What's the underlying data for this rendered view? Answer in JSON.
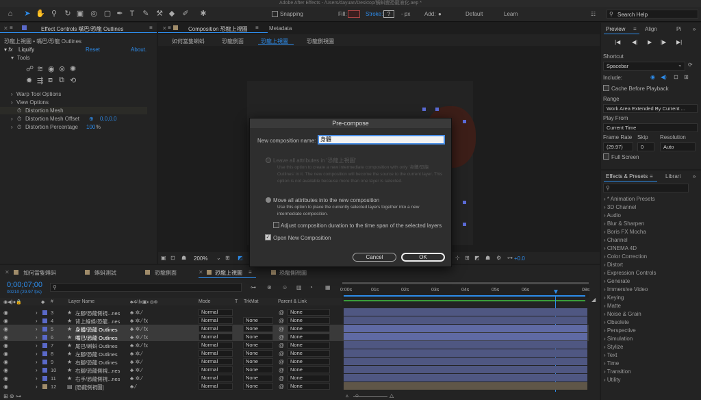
{
  "app": {
    "title": "Adobe After Effects - /Users/dayuan/Desktop/鯛蚪變恐龍液化.aep *"
  },
  "toolbar": {
    "snapping_label": "Snapping",
    "fill_label": "Fill:",
    "stroke_label": "Stroke:",
    "stroke_unit": "- px",
    "add_label": "Add:",
    "workspaces": [
      "Default",
      "Learn"
    ],
    "search_placeholder": "Search Help"
  },
  "effect_controls": {
    "tab_label": "Effect Controls 嘴巴/恐龍 Outlines",
    "breadcrumb": "恐龍上視圖 • 嘴巴/恐龍 Outlines",
    "effect_name": "Liquify",
    "reset_label": "Reset",
    "about_label": "About.",
    "tools_label": "Tools",
    "warp_tool_options": "Warp Tool Options",
    "view_options": "View Options",
    "distortion_mesh": "Distortion Mesh",
    "distortion_mesh_offset_label": "Distortion Mesh Offset",
    "distortion_mesh_offset_value": "0.0,0.0",
    "distortion_percentage_label": "Distortion Percentage",
    "distortion_percentage_value": "100",
    "distortion_percentage_unit": "%"
  },
  "composition": {
    "tab_label": "Composition 恐龍上視圖",
    "metadata_tab": "Metadata",
    "breadcrumbs": [
      "如何當隻蝌蚪",
      "恐龍側面",
      "恐龍上視圖",
      "恐龍側視圖"
    ],
    "zoom": "200%",
    "exposure": "+0.0"
  },
  "dialog": {
    "title": "Pre-compose",
    "name_label": "New composition name:",
    "name_value": "身體",
    "option1_label": "Leave all attributes in '恐龍上視圖'",
    "option1_desc": "Use this option to create a new intermediate composition with only '身體/恐龍 Outlines' in it. The new composition will become the source to the current layer. This option is not available because more than one layer is selected.",
    "option2_label": "Move all attributes into the new composition",
    "option2_desc": "Use this option to place the currently selected layers together into a new intermediate composition.",
    "adjust_label": "Adjust composition duration to the time span of the selected layers",
    "open_new_label": "Open New Composition",
    "cancel_label": "Cancel",
    "ok_label": "OK"
  },
  "preview": {
    "tab_label": "Preview",
    "align_tab": "Align",
    "p_tab": "Pi",
    "shortcut_label": "Shortcut",
    "shortcut_value": "Spacebar",
    "include_label": "Include:",
    "cache_label": "Cache Before Playback",
    "range_label": "Range",
    "range_value": "Work Area Extended By Current ...",
    "play_from_label": "Play From",
    "play_from_value": "Current Time",
    "frame_rate_label": "Frame Rate",
    "skip_label": "Skip",
    "resolution_label": "Resolution",
    "frame_rate_value": "(29.97)",
    "skip_value": "0",
    "resolution_value": "Auto",
    "full_screen_label": "Full Screen"
  },
  "effects_presets": {
    "tab_label": "Effects & Presets",
    "libraries_tab": "Librari",
    "items": [
      "* Animation Presets",
      "3D Channel",
      "Audio",
      "Blur & Sharpen",
      "Boris FX Mocha",
      "Channel",
      "CINEMA 4D",
      "Color Correction",
      "Distort",
      "Expression Controls",
      "Generate",
      "Immersive Video",
      "Keying",
      "Matte",
      "Noise & Grain",
      "Obsolete",
      "Perspective",
      "Simulation",
      "Stylize",
      "Text",
      "Time",
      "Transition",
      "Utility"
    ]
  },
  "timeline": {
    "tabs": [
      "如何當隻蝌蚪",
      "蝌蚪測試",
      "恐龍側面",
      "恐龍上視圖",
      "恐龍側視圖"
    ],
    "timecode": "0;00;07;00",
    "frame_info": "00210 (29.97 fps)",
    "col_layer_name": "Layer Name",
    "col_mode": "Mode",
    "col_t": "T",
    "col_trkmat": "TrkMat",
    "col_parent": "Parent & Link",
    "ruler": [
      "0:00s",
      "01s",
      "02s",
      "03s",
      "04s",
      "05s",
      "06s",
      "08s"
    ],
    "layers": [
      {
        "num": "3",
        "name": "左腳/恐龍側視...nes",
        "mode": "Normal",
        "trkmat": "",
        "parent": "None"
      },
      {
        "num": "4",
        "name": "背上線條/恐龍...nes",
        "mode": "Normal",
        "trkmat": "None",
        "parent": "None"
      },
      {
        "num": "5",
        "name": "身體/恐龍 Outlines",
        "mode": "Normal",
        "trkmat": "None",
        "parent": "None"
      },
      {
        "num": "6",
        "name": "嘴巴/恐龍 Outlines",
        "mode": "Normal",
        "trkmat": "None",
        "parent": "None"
      },
      {
        "num": "7",
        "name": "尾巴/蝌蚪 Outlines",
        "mode": "Normal",
        "trkmat": "None",
        "parent": "None"
      },
      {
        "num": "8",
        "name": "左腳/恐龍 Outlines",
        "mode": "Normal",
        "trkmat": "None",
        "parent": "None"
      },
      {
        "num": "9",
        "name": "右腳/恐龍 Outlines",
        "mode": "Normal",
        "trkmat": "None",
        "parent": "None"
      },
      {
        "num": "10",
        "name": "右腳/恐龍側視...nes",
        "mode": "Normal",
        "trkmat": "None",
        "parent": "None"
      },
      {
        "num": "11",
        "name": "右手/恐龍側視...nes",
        "mode": "Normal",
        "trkmat": "None",
        "parent": "None"
      },
      {
        "num": "12",
        "name": "[恐龍側視圖]",
        "mode": "Normal",
        "trkmat": "None",
        "parent": "None"
      }
    ]
  },
  "colors": {
    "accent": "#2d8ceb",
    "layer_bar": "#4f5782",
    "selected_bar": "#5f6aa4"
  }
}
